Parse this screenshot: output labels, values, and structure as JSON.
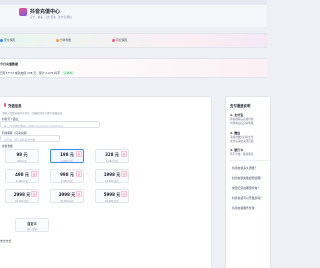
{
  "header": {
    "title": "抖音充值中心",
    "subtitle": "安全 · 快速 · 官方直充 · 支付宝/微信"
  },
  "features": [
    {
      "label": "安全保障",
      "color": "#3a8cf5"
    },
    {
      "label": "分钟到账",
      "color": "#ff9a3c"
    },
    {
      "label": "风控保障",
      "color": "#ff5a83"
    }
  ],
  "stats": {
    "title": "今日充值数据",
    "line": "已有37*72 成功充值 138 元，累计 2,274 抖币",
    "badge": "+15%"
  },
  "left_panel": {
    "title": "充值信息",
    "hint": "请输入需要充值的抖音号，请确保抖音号填写正确无误",
    "account_label": "抖音号 / 链接：",
    "account_placeholder": "如：2234567890 / https://v.douyin.com/xxxxx",
    "nickname_label": "抖音昵称（自动识别）",
    "nickname_placeholder": "可不填，填写后核对更方便",
    "amount_label": "充值金额",
    "amounts": [
      {
        "value": "98 元",
        "coins": "980 抖币",
        "badge": ""
      },
      {
        "value": "198 元",
        "coins": "1,980 抖币",
        "badge": "热"
      },
      {
        "value": "328 元",
        "coins": "3,280 抖币",
        "badge": "推"
      },
      {
        "value": "498 元",
        "coins": "4,980 抖币",
        "badge": "送"
      },
      {
        "value": "998 元",
        "coins": "9,980 抖币",
        "badge": "送"
      },
      {
        "value": "1998 元",
        "coins": "19,980 抖币",
        "badge": "送"
      },
      {
        "value": "2998 元",
        "coins": "29,980 抖币",
        "badge": "送"
      },
      {
        "value": "3998 元",
        "coins": "39,980 抖币",
        "badge": "送"
      },
      {
        "value": "5998 元",
        "coins": "59,980 抖币",
        "badge": "送"
      }
    ],
    "selected_index": 1,
    "custom": {
      "value": "自定义",
      "coins": "输入金额"
    },
    "pay_label": "支付方式"
  },
  "right_panel": {
    "title": "支付通道说明",
    "sections": [
      {
        "title": "1. 支付宝",
        "lines": [
          "请在跳转后完成付款，",
          "付款成功后自动到账。"
        ]
      },
      {
        "title": "2. 微信",
        "lines": [
          "请使用微信扫码支付，",
          "支付后请勿关闭页面。"
        ]
      },
      {
        "title": "3. 银行卡",
        "lines": [
          "暂不可用，敬请期待。"
        ]
      }
    ],
    "faqs": [
      "抖音充值多久到账？",
      "抖音充值失败如何处理？",
      "充值记录在哪里查询？",
      "抖音充值可以开发票吗？",
      "抖音充值服务条款"
    ]
  }
}
